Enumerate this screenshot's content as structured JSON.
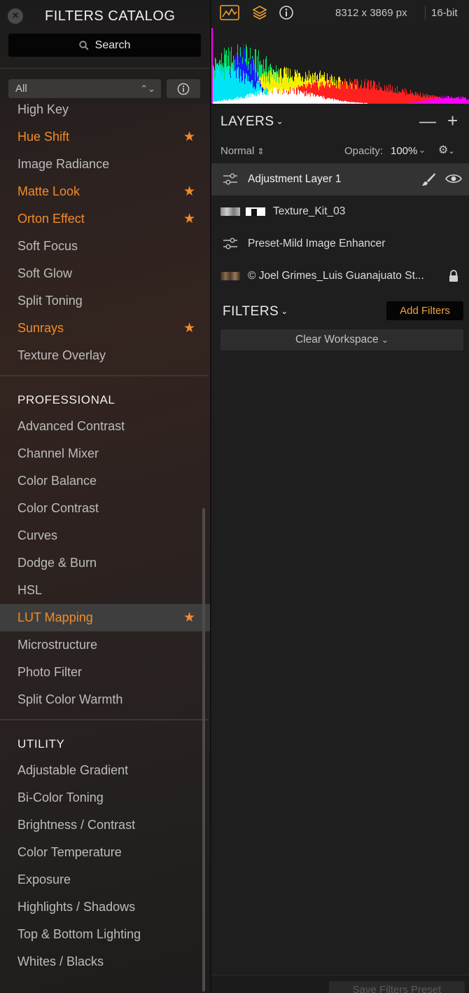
{
  "catalog": {
    "title": "FILTERS CATALOG",
    "search_placeholder": "Search",
    "category_select": "All",
    "filters_top": [
      {
        "label": "High Key",
        "favorite": false
      },
      {
        "label": "Hue Shift",
        "favorite": true
      },
      {
        "label": "Image Radiance",
        "favorite": false
      },
      {
        "label": "Matte Look",
        "favorite": true
      },
      {
        "label": "Orton Effect",
        "favorite": true
      },
      {
        "label": "Soft Focus",
        "favorite": false
      },
      {
        "label": "Soft Glow",
        "favorite": false
      },
      {
        "label": "Split Toning",
        "favorite": false
      },
      {
        "label": "Sunrays",
        "favorite": true
      },
      {
        "label": "Texture Overlay",
        "favorite": false
      }
    ],
    "professional": {
      "heading": "PROFESSIONAL",
      "items": [
        {
          "label": "Advanced Contrast",
          "favorite": false
        },
        {
          "label": "Channel Mixer",
          "favorite": false
        },
        {
          "label": "Color Balance",
          "favorite": false
        },
        {
          "label": "Color Contrast",
          "favorite": false
        },
        {
          "label": "Curves",
          "favorite": false
        },
        {
          "label": "Dodge & Burn",
          "favorite": false
        },
        {
          "label": "HSL",
          "favorite": false
        },
        {
          "label": "LUT Mapping",
          "favorite": true,
          "selected": true
        },
        {
          "label": "Microstructure",
          "favorite": false
        },
        {
          "label": "Photo Filter",
          "favorite": false
        },
        {
          "label": "Split Color Warmth",
          "favorite": false
        }
      ]
    },
    "utility": {
      "heading": "UTILITY",
      "items": [
        {
          "label": "Adjustable Gradient",
          "favorite": false
        },
        {
          "label": "Bi-Color Toning",
          "favorite": false
        },
        {
          "label": "Brightness / Contrast",
          "favorite": false
        },
        {
          "label": "Color Temperature",
          "favorite": false
        },
        {
          "label": "Exposure",
          "favorite": false
        },
        {
          "label": "Highlights / Shadows",
          "favorite": false
        },
        {
          "label": "Top & Bottom Lighting",
          "favorite": false
        },
        {
          "label": "Whites / Blacks",
          "favorite": false
        }
      ]
    },
    "favorite_color": "#f28b2a"
  },
  "topbar": {
    "icons": [
      "histogram-icon",
      "layers-icon",
      "info-icon"
    ],
    "image_size": "8312 x 3869 px",
    "bit_depth": "16-bit"
  },
  "layers": {
    "title": "LAYERS",
    "blend_mode": "Normal",
    "opacity_label": "Opacity:",
    "opacity_value": "100%",
    "items": [
      {
        "name": "Adjustment Layer 1",
        "type": "adjustment",
        "active": true
      },
      {
        "name": "Texture_Kit_03",
        "type": "texture",
        "active": false
      },
      {
        "name": "Preset-Mild Image Enhancer",
        "type": "adjustment",
        "active": false
      },
      {
        "name": "© Joel Grimes_Luis Guanajuato St...",
        "type": "image",
        "active": false,
        "locked": true
      }
    ]
  },
  "filters_panel": {
    "title": "FILTERS",
    "add_button": "Add Filters",
    "clear_workspace": "Clear Workspace",
    "save_preset": "Save Filters Preset"
  }
}
